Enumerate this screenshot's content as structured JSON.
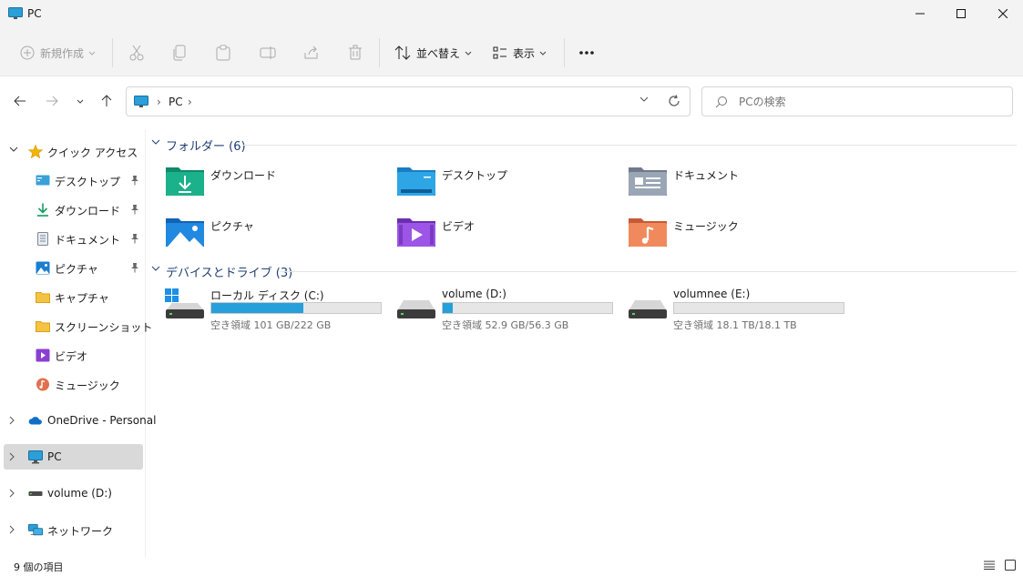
{
  "window": {
    "title": "PC"
  },
  "toolbar": {
    "new_label": "新規作成",
    "sort_label": "並べ替え",
    "view_label": "表示",
    "more_label": "..."
  },
  "address": {
    "crumbs": [
      "PC"
    ]
  },
  "search": {
    "placeholder": "PCの検索"
  },
  "sidebar": {
    "quick_access": "クイック アクセス",
    "items": [
      {
        "label": "デスクトップ",
        "pinned": true
      },
      {
        "label": "ダウンロード",
        "pinned": true
      },
      {
        "label": "ドキュメント",
        "pinned": true
      },
      {
        "label": "ピクチャ",
        "pinned": true
      },
      {
        "label": "キャプチャ",
        "pinned": false
      },
      {
        "label": "スクリーンショット",
        "pinned": false
      },
      {
        "label": "ビデオ",
        "pinned": false
      },
      {
        "label": "ミュージック",
        "pinned": false
      }
    ],
    "onedrive": "OneDrive - Personal",
    "pc": "PC",
    "volume_d": "volume (D:)",
    "network": "ネットワーク"
  },
  "content": {
    "folders_header": "フォルダー (6)",
    "folders": [
      {
        "label": "ダウンロード",
        "icon": "downloads-folder-icon"
      },
      {
        "label": "デスクトップ",
        "icon": "desktop-folder-icon"
      },
      {
        "label": "ドキュメント",
        "icon": "documents-folder-icon"
      },
      {
        "label": "ピクチャ",
        "icon": "pictures-folder-icon"
      },
      {
        "label": "ビデオ",
        "icon": "videos-folder-icon"
      },
      {
        "label": "ミュージック",
        "icon": "music-folder-icon"
      }
    ],
    "drives_header": "デバイスとドライブ (3)",
    "drives": [
      {
        "label": "ローカル ディスク (C:)",
        "free_text": "空き領域 101 GB/222 GB",
        "used_fraction": 0.545
      },
      {
        "label": "volume (D:)",
        "free_text": "空き領域 52.9 GB/56.3 GB",
        "used_fraction": 0.06
      },
      {
        "label": "volumnee (E:)",
        "free_text": "空き領域 18.1 TB/18.1 TB",
        "used_fraction": 0.0
      }
    ]
  },
  "status": {
    "item_count": "9 個の項目"
  },
  "colors": {
    "accent": "#26a0da",
    "group_header": "#1f3f73",
    "selected_bg": "#d9d9d9"
  }
}
